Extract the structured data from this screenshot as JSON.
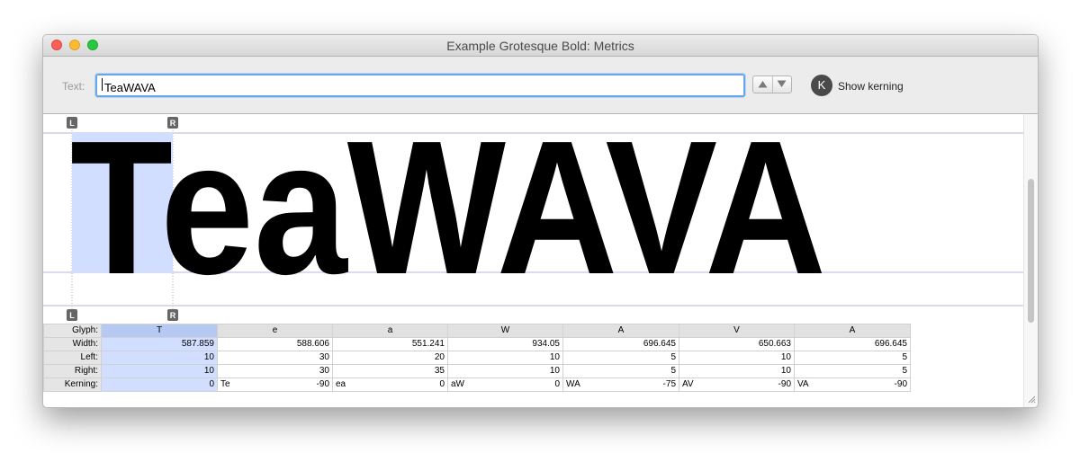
{
  "window": {
    "title": "Example Grotesque Bold: Metrics"
  },
  "toolbar": {
    "text_label": "Text:",
    "text_value": "TeaWAVA",
    "kerning_badge": "K",
    "kerning_label": "Show kerning"
  },
  "preview": {
    "sample_text": "TeaWAVA",
    "left_marker": "L",
    "right_marker": "R"
  },
  "metrics": {
    "row_labels": [
      "Glyph:",
      "Width:",
      "Left:",
      "Right:",
      "Kerning:"
    ],
    "columns": [
      {
        "glyph": "T",
        "width": "587.859",
        "left": "10",
        "right": "10",
        "pair": "",
        "kerning": "0"
      },
      {
        "glyph": "e",
        "width": "588.606",
        "left": "30",
        "right": "30",
        "pair": "Te",
        "kerning": "-90"
      },
      {
        "glyph": "a",
        "width": "551.241",
        "left": "20",
        "right": "35",
        "pair": "ea",
        "kerning": "0"
      },
      {
        "glyph": "W",
        "width": "934.05",
        "left": "10",
        "right": "10",
        "pair": "aW",
        "kerning": "0"
      },
      {
        "glyph": "A",
        "width": "696.645",
        "left": "5",
        "right": "5",
        "pair": "WA",
        "kerning": "-75"
      },
      {
        "glyph": "V",
        "width": "650.663",
        "left": "10",
        "right": "10",
        "pair": "AV",
        "kerning": "-90"
      },
      {
        "glyph": "A",
        "width": "696.645",
        "left": "5",
        "right": "5",
        "pair": "VA",
        "kerning": "-90"
      }
    ]
  },
  "colors": {
    "selection": "#d2deff",
    "focus_ring": "#6aa6e8",
    "guide_line": "#b7b7e0"
  }
}
